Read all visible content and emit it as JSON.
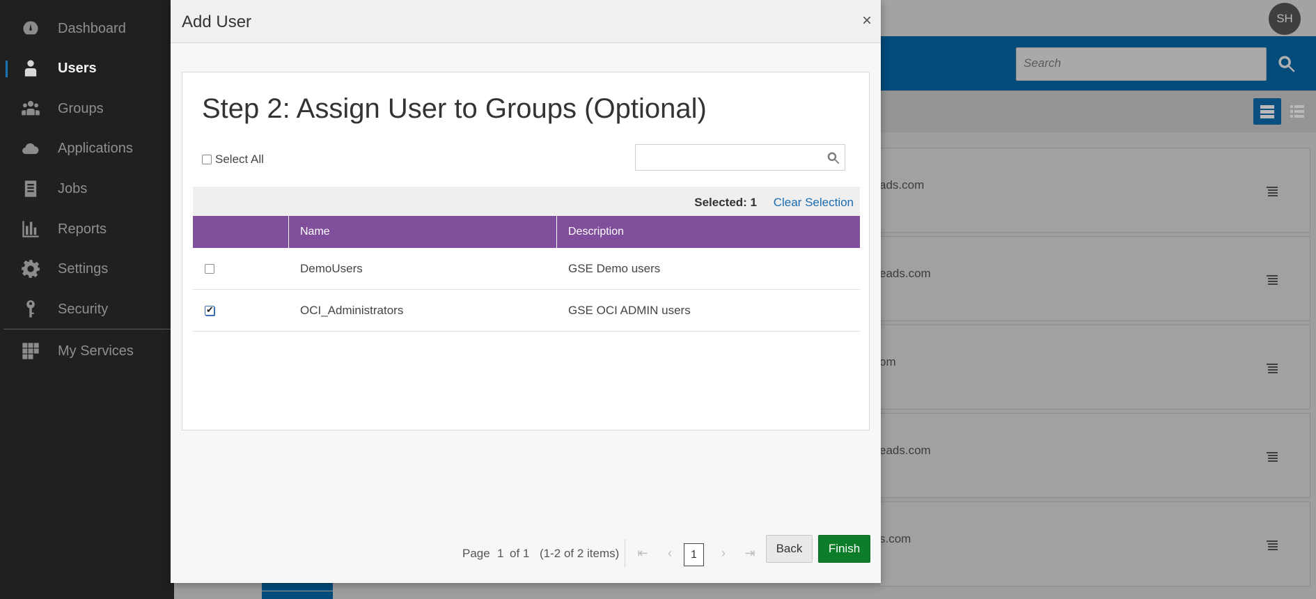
{
  "sidebar": {
    "items": [
      {
        "label": "Dashboard",
        "icon": "dashboard-icon",
        "active": false
      },
      {
        "label": "Users",
        "icon": "user-icon",
        "active": true
      },
      {
        "label": "Groups",
        "icon": "group-icon",
        "active": false
      },
      {
        "label": "Applications",
        "icon": "cloud-icon",
        "active": false
      },
      {
        "label": "Jobs",
        "icon": "jobs-icon",
        "active": false
      },
      {
        "label": "Reports",
        "icon": "bar-chart-icon",
        "active": false
      },
      {
        "label": "Settings",
        "icon": "gear-icon",
        "active": false
      },
      {
        "label": "Security",
        "icon": "key-icon",
        "active": false
      },
      {
        "label": "My Services",
        "icon": "grid-icon",
        "active": false
      }
    ]
  },
  "header": {
    "avatar_initials": "SH",
    "search_placeholder": "Search"
  },
  "background_cards": [
    {
      "text": "ads.com"
    },
    {
      "text": "eads.com"
    },
    {
      "text": "om"
    },
    {
      "text": "eads.com"
    },
    {
      "text": "s.com"
    }
  ],
  "modal": {
    "title": "Add User",
    "close_label": "×",
    "step_title": "Step 2: Assign User to Groups (Optional)",
    "select_all_label": "Select All",
    "selected_label": "Selected: 1",
    "clear_selection_label": "Clear Selection",
    "table": {
      "columns": [
        "Name",
        "Description"
      ],
      "rows": [
        {
          "name": "DemoUsers",
          "description": "GSE Demo users",
          "checked": false
        },
        {
          "name": "OCI_Administrators",
          "description": "GSE OCI ADMIN users",
          "checked": true
        }
      ]
    },
    "pager": {
      "page_label": "Page",
      "page_value": "1",
      "of_label": "of 1",
      "items_label": "(1-2 of 2 items)",
      "current_page": "1"
    },
    "back_label": "Back",
    "finish_label": "Finish"
  },
  "colors": {
    "sidebar_bg": "#1f2120",
    "header_blue": "#024b7a",
    "table_header": "#804e9a",
    "finish_green": "#0d7d2a",
    "link_blue": "#1b6bb0"
  }
}
